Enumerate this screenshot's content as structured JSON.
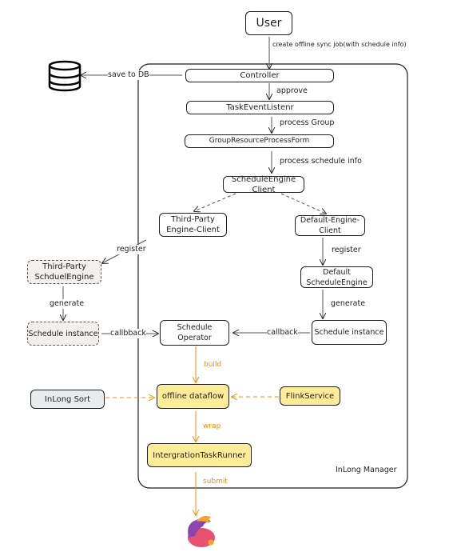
{
  "nodes": {
    "user": "User",
    "controller": "Controller",
    "task_event_listener": "TaskEventListenr",
    "group_resource_process_form": "GroupResourceProcessForm",
    "schedule_engine_client": "ScheduleEngine Client",
    "third_party_engine_client": "Third-Party\nEngine-Client",
    "default_engine_client": "Default-Engine-Client",
    "third_party_schedule_engine": "Third-Party\nSchduelEngine",
    "default_schedule_engine": "Default ScheduleEngine",
    "schedule_instance_left": "Schedule instance",
    "schedule_instance_right": "Schedule instance",
    "schedule_operator": "Schedule Operator",
    "offline_dataflow": "offline dataflow",
    "inlong_sort": "InLong Sort",
    "flink_service": "FlinkService",
    "integration_task_runner": "IntergrationTaskRunner",
    "container_label": "InLong Manager"
  },
  "edges": {
    "create_job": "create offline sync job(with schedule info)",
    "save_to_db": "save to DB",
    "approve": "approve",
    "process_group": "process Group",
    "process_schedule_info": "process schedule info",
    "register_left": "register",
    "register_right": "register",
    "generate_left": "generate",
    "generate_right": "generate",
    "callback_left": "callbback",
    "callback_right": "callback",
    "build": "build",
    "wrap": "wrap",
    "submit": "submit"
  },
  "icons": {
    "database": "database-icon",
    "flink": "flink-squirrel-logo"
  },
  "colors": {
    "highlight": "#ffec99",
    "flow_orange": "#f08c00",
    "external_grey": "#e9ecef",
    "dashed_fill": "#f3efec"
  }
}
